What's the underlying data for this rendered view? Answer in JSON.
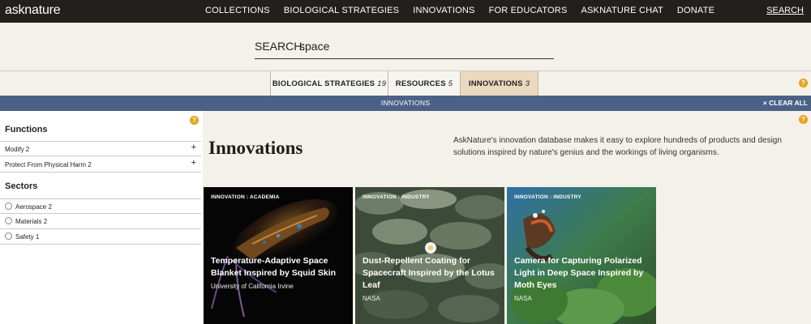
{
  "nav": {
    "logo": "asknature",
    "links": [
      "COLLECTIONS",
      "BIOLOGICAL STRATEGIES",
      "INNOVATIONS",
      "FOR EDUCATORS",
      "ASKNATURE CHAT",
      "DONATE"
    ],
    "search_link": "SEARCH"
  },
  "search": {
    "label": "SEARCH:",
    "value": "space"
  },
  "tabs": [
    {
      "label": "BIOLOGICAL STRATEGIES",
      "count": "19"
    },
    {
      "label": "RESOURCES",
      "count": "5"
    },
    {
      "label": "INNOVATIONS",
      "count": "3"
    }
  ],
  "filter_bar": {
    "title": "INNOVATIONS",
    "clear_label": "CLEAR ALL",
    "clear_icon": "×"
  },
  "sidebar": {
    "functions_heading": "Functions",
    "functions": [
      {
        "label": "Modify",
        "count": "2"
      },
      {
        "label": "Protect From Physical Harm",
        "count": "2"
      }
    ],
    "sectors_heading": "Sectors",
    "sectors": [
      {
        "label": "Aerospace",
        "count": "2"
      },
      {
        "label": "Materials",
        "count": "2"
      },
      {
        "label": "Safety",
        "count": "1"
      }
    ]
  },
  "main": {
    "title": "Innovations",
    "description": "AskNature's innovation database makes it easy to explore hundreds of products and design solutions inspired by nature's genius and the workings of living organisms."
  },
  "cards": [
    {
      "kicker": "INNOVATION : ACADEMIA",
      "title": "Temperature-Adaptive Space Blanket Inspired by Squid Skin",
      "org": "University of California Irvine"
    },
    {
      "kicker": "INNOVATION : INDUSTRY",
      "title": "Dust-Repellent Coating for Spacecraft Inspired by the Lotus Leaf",
      "org": "NASA"
    },
    {
      "kicker": "INNOVATION : INDUSTRY",
      "title": "Camera for Capturing Polarized Light in Deep Space Inspired by Moth Eyes",
      "org": "NASA"
    }
  ],
  "colors": {
    "nav_bg": "#231f1d",
    "page_bg": "#f4f1ea",
    "filter_bar": "#4b6286",
    "active_tab": "#ead9bf",
    "help_icon": "#e9a21d"
  },
  "icons": {
    "help": "?",
    "plus": "+"
  }
}
